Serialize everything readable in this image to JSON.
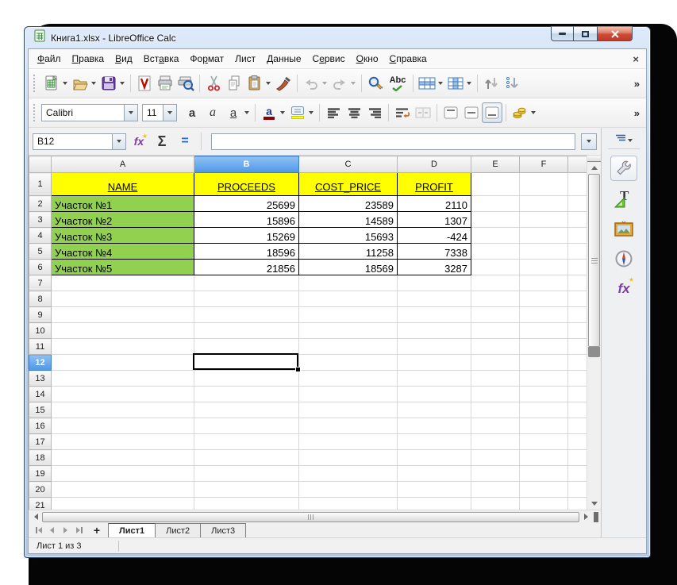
{
  "window": {
    "title": "Книга1.xlsx - LibreOffice Calc"
  },
  "menubar": {
    "items": [
      {
        "label": "Файл",
        "u": 0
      },
      {
        "label": "Правка",
        "u": 0
      },
      {
        "label": "Вид",
        "u": 0
      },
      {
        "label": "Вставка",
        "u": 3
      },
      {
        "label": "Формат",
        "u": 2
      },
      {
        "label": "Лист",
        "u": -1
      },
      {
        "label": "Данные",
        "u": 0
      },
      {
        "label": "Сервис",
        "u": 1
      },
      {
        "label": "Окно",
        "u": 0
      },
      {
        "label": "Справка",
        "u": 0
      }
    ],
    "close_glyph": "×"
  },
  "toolbar_standard": {
    "buttons": [
      "new-document",
      "open",
      "save",
      "export-pdf",
      "print",
      "print-preview",
      "cut",
      "copy",
      "paste",
      "clone-formatting",
      "undo",
      "redo",
      "find-replace",
      "spelling",
      "row",
      "column",
      "sort",
      "sort-descending"
    ],
    "spelling_label": "Abc",
    "overflow_glyph": "»"
  },
  "toolbar_formatting": {
    "font_name": "Calibri",
    "font_size": "11",
    "bold_glyph": "a",
    "italic_glyph": "a",
    "underline_glyph": "a",
    "font_color_glyph": "a",
    "buttons": [
      "bold",
      "italic",
      "underline",
      "font-color",
      "highlight-color",
      "align-left",
      "align-center",
      "align-right",
      "wrap-text",
      "merge-cells",
      "align-top",
      "align-vcenter",
      "align-bottom",
      "currency-format"
    ],
    "overflow_glyph": "»"
  },
  "formula_bar": {
    "cell_reference": "B12",
    "formula_value": "",
    "function_glyph": "fx",
    "sum_glyph": "Σ",
    "equals_glyph": "=",
    "star_glyph": "★"
  },
  "grid": {
    "columns": [
      "A",
      "B",
      "C",
      "D",
      "E",
      "F"
    ],
    "visible_rows": 21,
    "selected_cell": "B12",
    "selected_column": "B",
    "selected_row": 12
  },
  "table": {
    "header": [
      "NAME",
      "PROCEEDS",
      "COST_PRICE",
      "PROFIT"
    ],
    "rows": [
      [
        "Участок №1",
        "25699",
        "23589",
        "2110"
      ],
      [
        "Участок №2",
        "15896",
        "14589",
        "1307"
      ],
      [
        "Участок №3",
        "15269",
        "15693",
        "-424"
      ],
      [
        "Участок №4",
        "18596",
        "11258",
        "7338"
      ],
      [
        "Участок №5",
        "21856",
        "18569",
        "3287"
      ]
    ],
    "header_bg": "#ffff00",
    "name_bg": "#92d050"
  },
  "sheet_tabs": {
    "add_glyph": "+",
    "tabs": [
      {
        "label": "Лист1",
        "active": true
      },
      {
        "label": "Лист2",
        "active": false
      },
      {
        "label": "Лист3",
        "active": false
      }
    ]
  },
  "status_bar": {
    "text": "Лист 1 из 3"
  },
  "sidebar": {
    "icons": [
      "sidebar-settings",
      "properties",
      "styles",
      "gallery",
      "navigator",
      "functions"
    ],
    "fx_glyph": "fx",
    "star_glyph": "★"
  },
  "colors": {
    "selection_blue": "#4e97e8",
    "header_yellow": "#ffff00",
    "cell_green": "#92d050",
    "close_red": "#c0392a",
    "aero_blue": "#bfd4ea"
  }
}
